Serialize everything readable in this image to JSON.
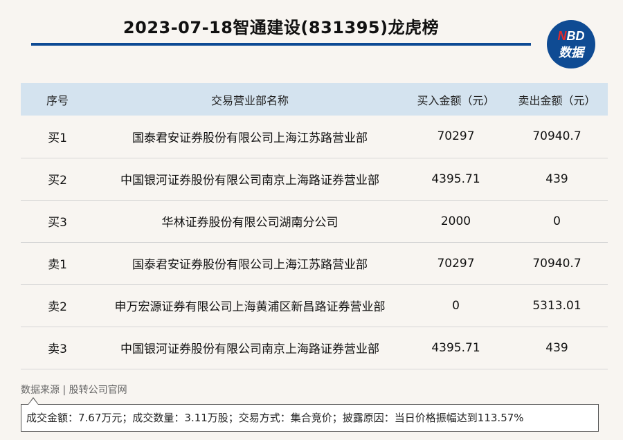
{
  "title": "2023-07-18智通建设(831395)龙虎榜",
  "logo": {
    "line1_n": "N",
    "line1_rest": "BD",
    "line2": "数据"
  },
  "table": {
    "headers": [
      "序号",
      "交易营业部名称",
      "买入金额（元）",
      "卖出金额（元）"
    ],
    "rows": [
      [
        "买1",
        "国泰君安证券股份有限公司上海江苏路营业部",
        "70297",
        "70940.7"
      ],
      [
        "买2",
        "中国银河证券股份有限公司南京上海路证券营业部",
        "4395.71",
        "439"
      ],
      [
        "买3",
        "华林证券股份有限公司湖南分公司",
        "2000",
        "0"
      ],
      [
        "卖1",
        "国泰君安证券股份有限公司上海江苏路营业部",
        "70297",
        "70940.7"
      ],
      [
        "卖2",
        "申万宏源证券有限公司上海黄浦区新昌路证券营业部",
        "0",
        "5313.01"
      ],
      [
        "卖3",
        "中国银河证券股份有限公司南京上海路证券营业部",
        "4395.71",
        "439"
      ]
    ]
  },
  "source": "数据来源 | 股转公司官网",
  "note": "成交金额：7.67万元；成交数量：3.11万股；交易方式：集合竞价；披露原因：当日价格振幅达到113.57%",
  "colors": {
    "accent": "#0d4a94",
    "header_bg": "#d4e3ef",
    "logo_red": "#e52a2a"
  }
}
